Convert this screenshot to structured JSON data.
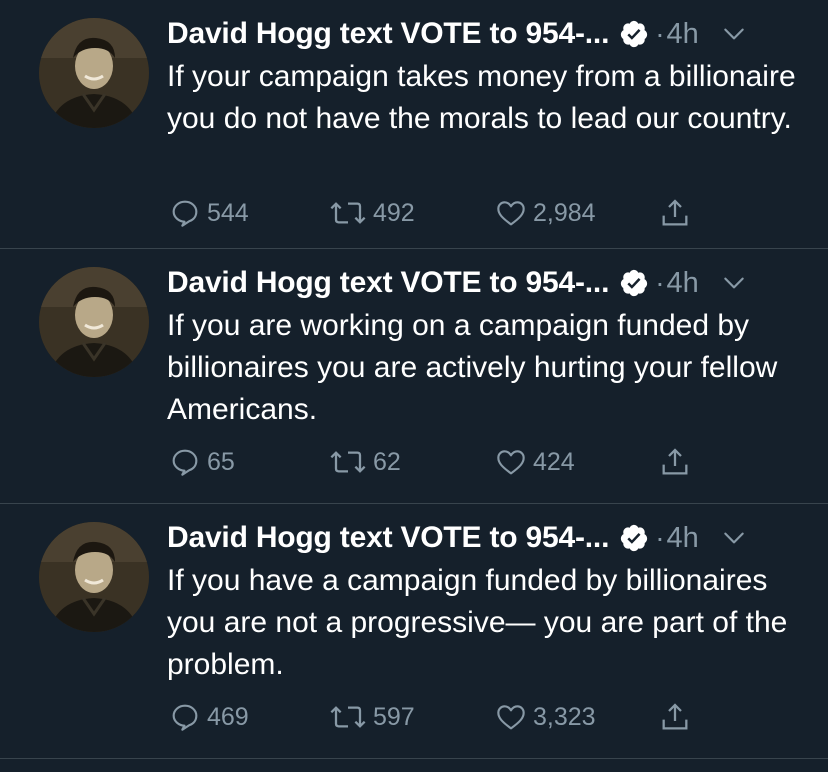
{
  "colors": {
    "background": "#15202b",
    "divider": "#38444d",
    "text": "#ffffff",
    "muted": "#8899a6"
  },
  "tweets": [
    {
      "author": "David Hogg text VOTE to 954-...",
      "separator": "·",
      "time": "4h",
      "text": "If your campaign takes money from a billionaire you do not have the morals to lead our country.",
      "replies": "544",
      "retweets": "492",
      "likes": "2,984",
      "icons": [
        "verified-icon",
        "chevron-down-icon",
        "reply-icon",
        "retweet-icon",
        "like-icon",
        "share-icon"
      ]
    },
    {
      "author": "David Hogg text VOTE to 954-...",
      "separator": "·",
      "time": "4h",
      "text": "If you are working on a campaign funded by billionaires you are actively hurting your fellow Americans.",
      "replies": "65",
      "retweets": "62",
      "likes": "424",
      "icons": [
        "verified-icon",
        "chevron-down-icon",
        "reply-icon",
        "retweet-icon",
        "like-icon",
        "share-icon"
      ]
    },
    {
      "author": "David Hogg text VOTE to 954-...",
      "separator": "·",
      "time": "4h",
      "text": "If you have a campaign funded by billionaires you are not a progressive— you are part of the problem.",
      "replies": "469",
      "retweets": "597",
      "likes": "3,323",
      "icons": [
        "verified-icon",
        "chevron-down-icon",
        "reply-icon",
        "retweet-icon",
        "like-icon",
        "share-icon"
      ]
    }
  ]
}
